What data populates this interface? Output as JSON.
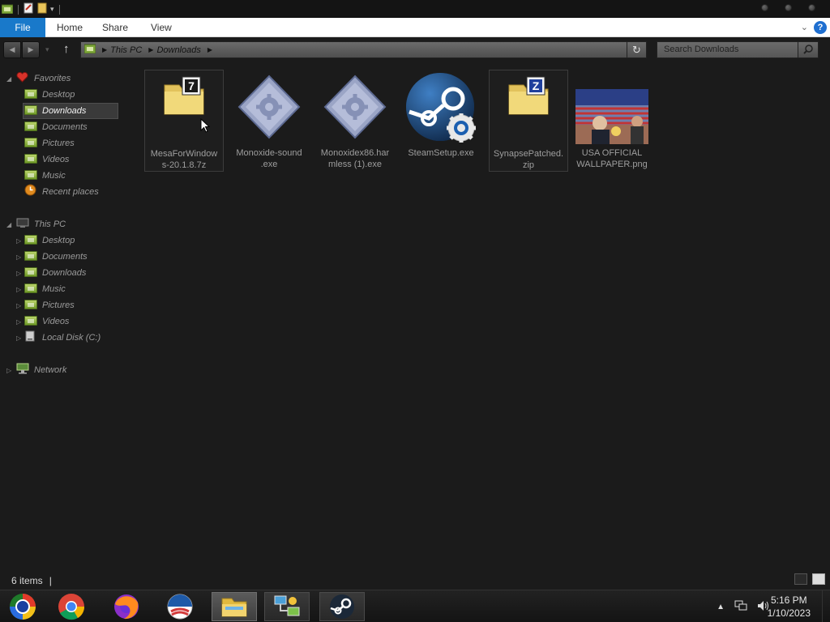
{
  "ribbon": {
    "tabs": [
      {
        "label": "File"
      },
      {
        "label": "Home"
      },
      {
        "label": "Share"
      },
      {
        "label": "View"
      }
    ],
    "help_label": "?"
  },
  "address_bar": {
    "crumbs": [
      "This PC",
      "Downloads"
    ]
  },
  "search": {
    "placeholder": "Search Downloads"
  },
  "sidebar": {
    "favorites": {
      "label": "Favorites",
      "items": [
        {
          "label": "Desktop"
        },
        {
          "label": "Downloads",
          "selected": true
        },
        {
          "label": "Documents"
        },
        {
          "label": "Pictures"
        },
        {
          "label": "Videos"
        },
        {
          "label": "Music"
        },
        {
          "label": "Recent places"
        }
      ]
    },
    "this_pc": {
      "label": "This PC",
      "items": [
        {
          "label": "Desktop"
        },
        {
          "label": "Documents"
        },
        {
          "label": "Downloads"
        },
        {
          "label": "Music"
        },
        {
          "label": "Pictures"
        },
        {
          "label": "Videos"
        },
        {
          "label": "Local Disk (C:)"
        }
      ]
    },
    "network": {
      "label": "Network"
    }
  },
  "files": [
    {
      "line1": "MesaForWindow",
      "line2": "s-20.1.8.7z",
      "icon": "7z-archive-icon"
    },
    {
      "line1": "Monoxide-sound",
      "line2": ".exe",
      "icon": "executable-icon"
    },
    {
      "line1": "Monoxidex86.har",
      "line2": "mless (1).exe",
      "icon": "executable-icon"
    },
    {
      "line1": "SteamSetup.exe",
      "line2": "",
      "icon": "steam-icon"
    },
    {
      "line1": "SynapsePatched.",
      "line2": "zip",
      "icon": "zip-archive-icon"
    },
    {
      "line1": "USA OFFICIAL",
      "line2": "WALLPAPER.png",
      "icon": "image-thumbnail"
    }
  ],
  "status_bar": {
    "item_count": "6 items"
  },
  "taskbar": {
    "time": "5:16 PM",
    "date": "1/10/2023"
  },
  "colors": {
    "file_tab": "#1979ca",
    "background": "#1b1b1b",
    "sidebar_folder": "#8fb23c"
  }
}
